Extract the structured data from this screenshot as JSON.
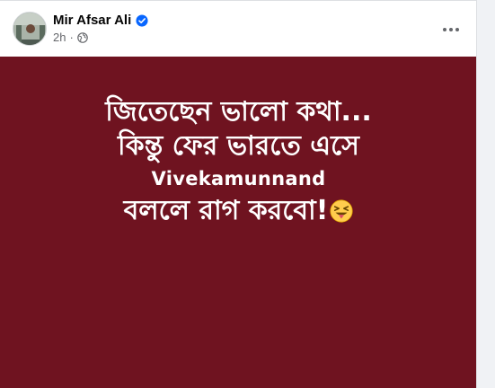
{
  "post": {
    "author": "Mir Afsar Ali",
    "verified": true,
    "timestamp": "2h",
    "audience_icon": "globe-icon",
    "more_icon": "more-options-icon"
  },
  "image": {
    "background_color": "#6f1320",
    "text_color": "#ffffff",
    "lines": [
      "জিতেছেন ভালো কথা...",
      "কিন্তু ফের ভারতে এসে",
      "Vivekamunnand",
      "বললে রাগ করবো!"
    ],
    "emoji": "squinting-face-with-tongue-icon"
  },
  "colors": {
    "verified_badge": "#0866ff",
    "secondary_text": "#65676b"
  }
}
